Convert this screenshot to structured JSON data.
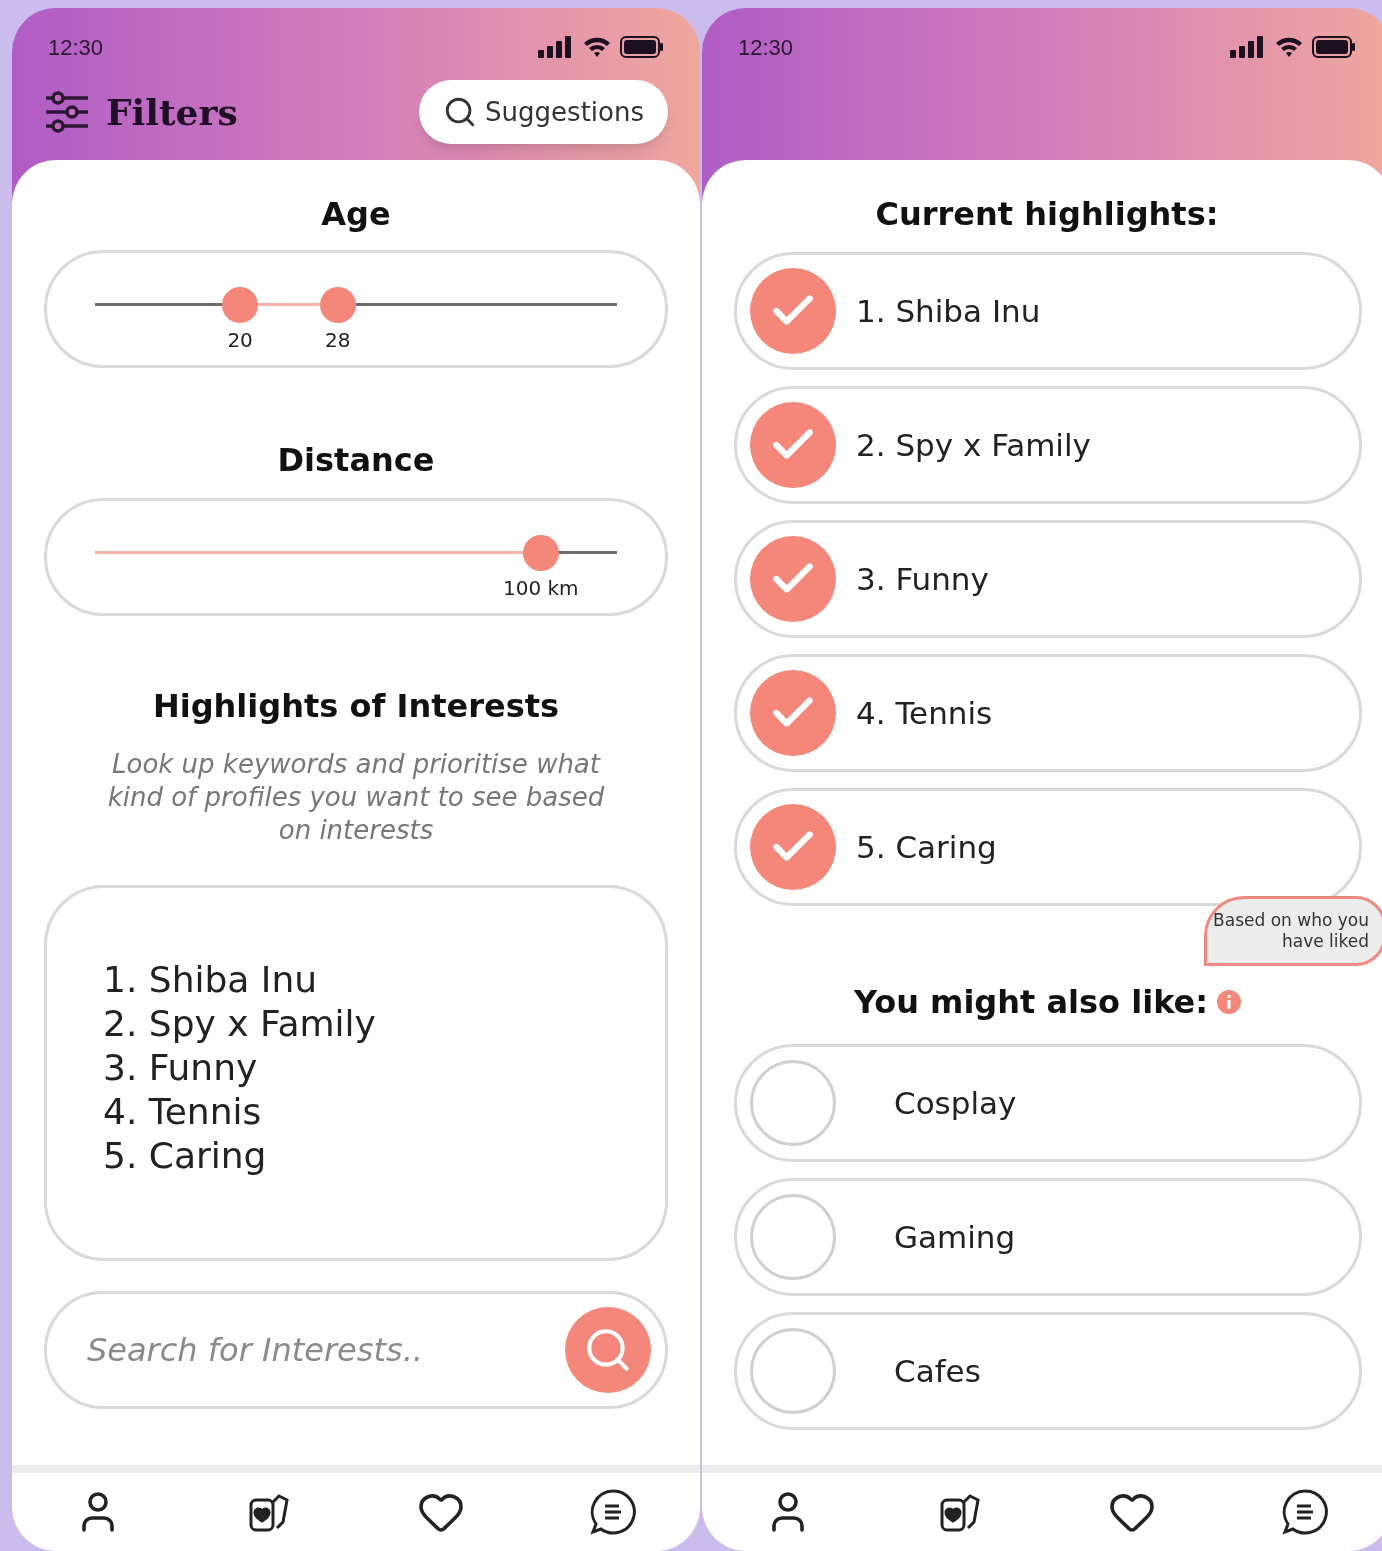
{
  "filters_screen": {
    "status_time": "12:30",
    "title": "Filters",
    "suggestions_button": "Suggestions",
    "age": {
      "title": "Age",
      "thumbs": [
        {
          "level": 0.278,
          "label": "20"
        },
        {
          "level": 0.465,
          "label": "28"
        }
      ]
    },
    "distance": {
      "title": "Distance",
      "thumbs": [
        {
          "level": 0.854,
          "label": "100 km"
        }
      ]
    },
    "highlights": {
      "title": "Highlights of Interests",
      "description": "Look up keywords and prioritise what kind of profiles you want to see based on interests",
      "items": [
        "1. Shiba Inu",
        "2. Spy x Family",
        "3. Funny",
        "4. Tennis",
        "5. Caring"
      ]
    },
    "search": {
      "placeholder": "Search for Interests.."
    }
  },
  "suggestions_screen": {
    "status_time": "12:30",
    "current_title": "Current highlights:",
    "current_items": [
      {
        "label": "1. Shiba Inu",
        "checked": true
      },
      {
        "label": "2. Spy x Family",
        "checked": true
      },
      {
        "label": "3. Funny",
        "checked": true
      },
      {
        "label": "4. Tennis",
        "checked": true
      },
      {
        "label": "5. Caring",
        "checked": true
      }
    ],
    "tooltip": "Based on who you have liked",
    "also_title": "You might also like:",
    "also_items": [
      {
        "label": "Cosplay",
        "checked": false
      },
      {
        "label": "Gaming",
        "checked": false
      },
      {
        "label": "Cafes",
        "checked": false
      }
    ]
  }
}
